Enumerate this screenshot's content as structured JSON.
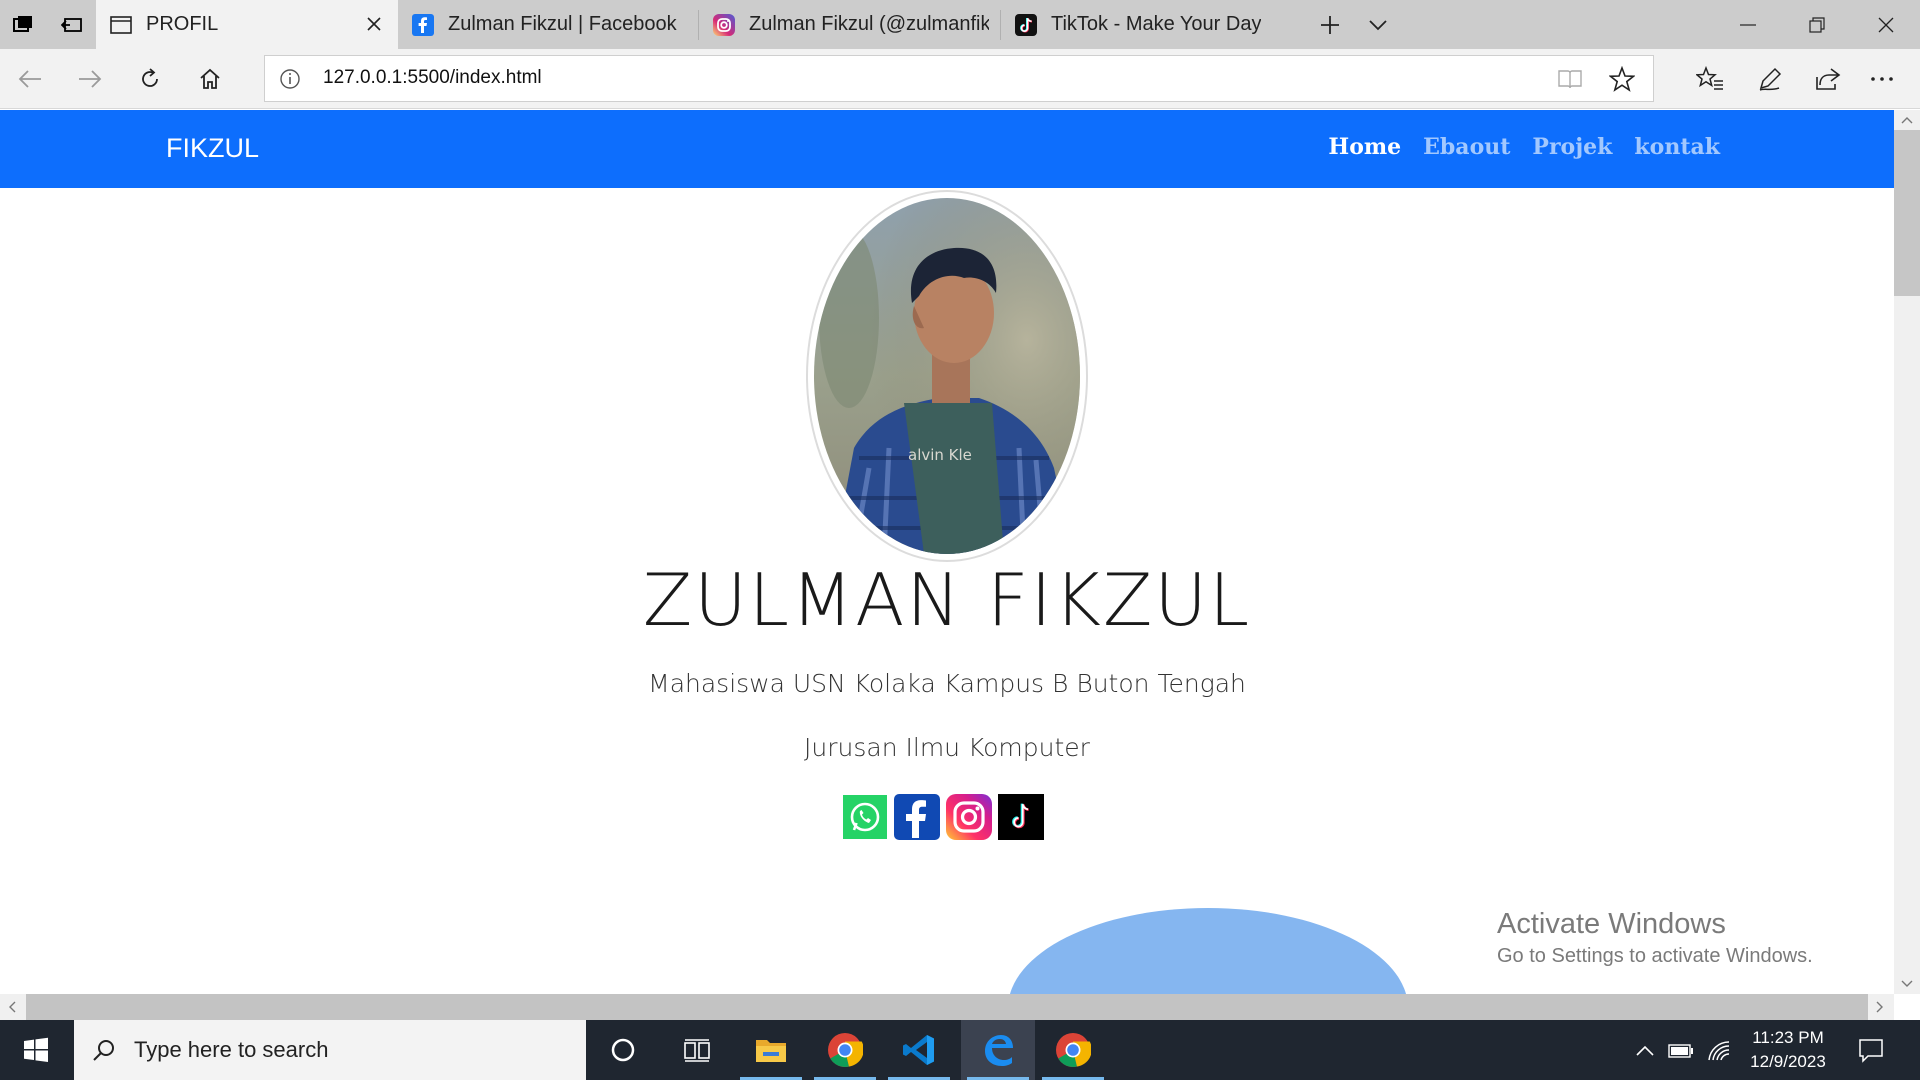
{
  "browser": {
    "tabs": [
      {
        "label": "PROFIL",
        "active": true
      },
      {
        "label": "Zulman Fikzul | Facebook",
        "active": false
      },
      {
        "label": "Zulman Fikzul (@zulmanfikzul)",
        "active": false
      },
      {
        "label": "TikTok - Make Your Day",
        "active": false
      }
    ],
    "url": "127.0.0.1:5500/index.html",
    "accent": "#cccccc"
  },
  "site": {
    "brand": "FIKZUL",
    "menu": [
      {
        "label": "Home",
        "active": true
      },
      {
        "label": "Ebaout",
        "active": false
      },
      {
        "label": "Projek",
        "active": false
      },
      {
        "label": "kontak",
        "active": false
      }
    ],
    "name": "ZULMAN FIKZUL",
    "subtitle": "Mahasiswa USN Kolaka Kampus B Buton Tengah",
    "major": "Jurusan Ilmu Komputer",
    "shirt_text": "alvin Kle",
    "socials": [
      "whatsapp-icon",
      "facebook-icon",
      "instagram-icon",
      "tiktok-icon"
    ],
    "nav_color": "#0d6efd"
  },
  "watermark": {
    "title": "Activate Windows",
    "subtitle": "Go to Settings to activate Windows."
  },
  "taskbar": {
    "search_placeholder": "Type here to search",
    "time": "11:23 PM",
    "date": "12/9/2023"
  }
}
